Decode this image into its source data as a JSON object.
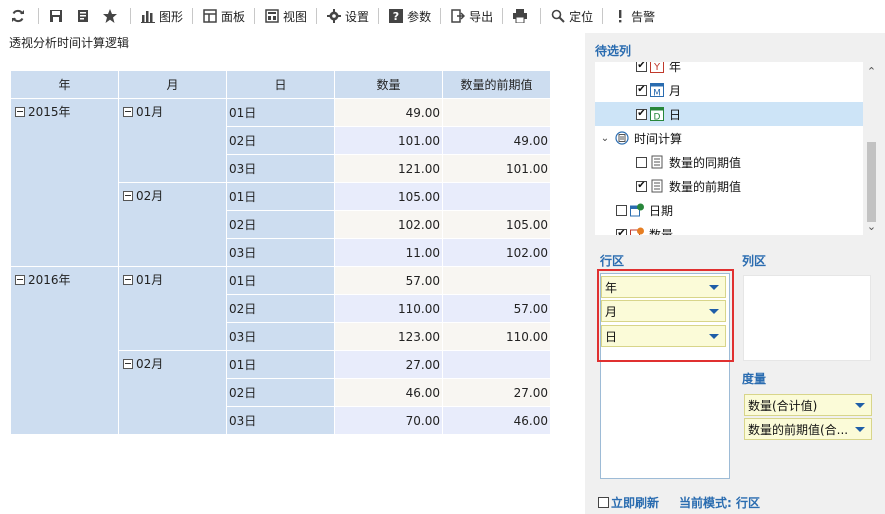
{
  "toolbar": {
    "items": [
      {
        "icon": "refresh-icon",
        "label": ""
      },
      {
        "icon": "save-icon",
        "label": ""
      },
      {
        "icon": "save-as-icon",
        "label": ""
      },
      {
        "icon": "star-icon",
        "label": ""
      },
      {
        "icon": "chart-icon",
        "label": "图形"
      },
      {
        "icon": "panel-icon",
        "label": "面板"
      },
      {
        "icon": "view-icon",
        "label": "视图"
      },
      {
        "icon": "gear-icon",
        "label": "设置"
      },
      {
        "icon": "help-icon",
        "label": "参数"
      },
      {
        "icon": "export-icon",
        "label": "导出"
      },
      {
        "icon": "print-icon",
        "label": ""
      },
      {
        "icon": "locate-icon",
        "label": "定位"
      },
      {
        "icon": "alert-icon",
        "label": "告警"
      }
    ]
  },
  "page": {
    "title": "透视分析时间计算逻辑"
  },
  "pivot": {
    "headers": [
      "年",
      "月",
      "日",
      "数量",
      "数量的前期值"
    ],
    "years": [
      {
        "year": "2015年",
        "months": [
          {
            "month": "01月",
            "days": [
              {
                "day": "01日",
                "qty": "49.00",
                "prev": ""
              },
              {
                "day": "02日",
                "qty": "101.00",
                "prev": "49.00"
              },
              {
                "day": "03日",
                "qty": "121.00",
                "prev": "101.00"
              }
            ]
          },
          {
            "month": "02月",
            "days": [
              {
                "day": "01日",
                "qty": "105.00",
                "prev": ""
              },
              {
                "day": "02日",
                "qty": "102.00",
                "prev": "105.00"
              },
              {
                "day": "03日",
                "qty": "11.00",
                "prev": "102.00"
              }
            ]
          }
        ]
      },
      {
        "year": "2016年",
        "months": [
          {
            "month": "01月",
            "days": [
              {
                "day": "01日",
                "qty": "57.00",
                "prev": ""
              },
              {
                "day": "02日",
                "qty": "110.00",
                "prev": "57.00"
              },
              {
                "day": "03日",
                "qty": "123.00",
                "prev": "110.00"
              }
            ]
          },
          {
            "month": "02月",
            "days": [
              {
                "day": "01日",
                "qty": "27.00",
                "prev": ""
              },
              {
                "day": "02日",
                "qty": "46.00",
                "prev": "27.00"
              },
              {
                "day": "03日",
                "qty": "70.00",
                "prev": "46.00"
              }
            ]
          }
        ]
      }
    ]
  },
  "panel": {
    "fields_title": "待选列",
    "fields": {
      "year": {
        "label": "年",
        "checked": true
      },
      "month": {
        "label": "月",
        "checked": true
      },
      "day": {
        "label": "日",
        "checked": true
      },
      "time_calc": {
        "label": "时间计算"
      },
      "same_period": {
        "label": "数量的同期值",
        "checked": false
      },
      "prev_period": {
        "label": "数量的前期值",
        "checked": true
      },
      "date": {
        "label": "日期",
        "checked": false
      },
      "partial": {
        "label": "数量"
      }
    },
    "row_zone_title": "行区",
    "col_zone_title": "列区",
    "measure_title": "度量",
    "row_items": [
      "年",
      "月",
      "日"
    ],
    "measure_items": [
      "数量(合计值)",
      "数量的前期值(合..."
    ],
    "refresh_label": "立即刷新",
    "mode_label": "当前模式: 行区"
  },
  "colors": {
    "accent": "#2a6cb0",
    "header_bg": "#cdddf0",
    "highlight_box": "#e03030",
    "chip_bg": "#fbfbd8"
  }
}
